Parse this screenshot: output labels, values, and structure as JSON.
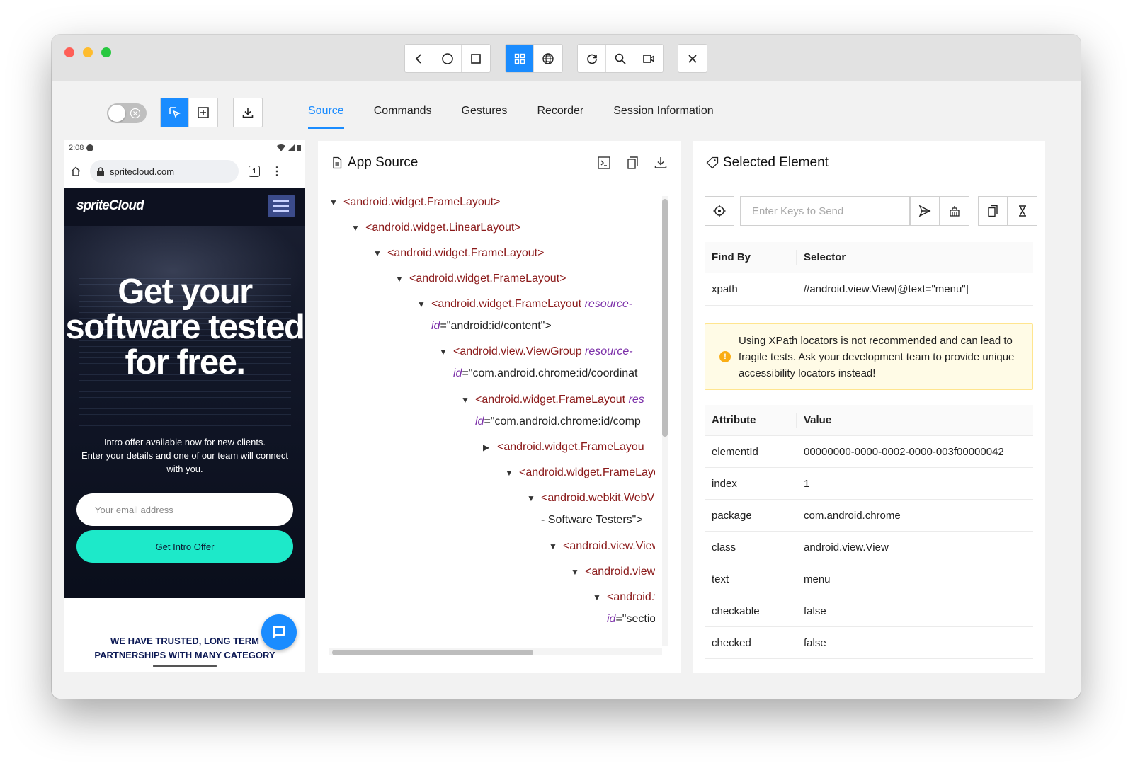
{
  "toolbar": {
    "top_icons": [
      "back-icon",
      "home-circle-icon",
      "app-switch-square-icon",
      "native-grid-icon",
      "web-globe-icon",
      "refresh-icon",
      "search-icon",
      "record-video-icon",
      "close-icon"
    ]
  },
  "mode_tabs": [
    {
      "label": "Source",
      "active": true
    },
    {
      "label": "Commands",
      "active": false
    },
    {
      "label": "Gestures",
      "active": false
    },
    {
      "label": "Recorder",
      "active": false
    },
    {
      "label": "Session Information",
      "active": false
    }
  ],
  "device": {
    "time": "2:08",
    "url": "spritecloud.com",
    "tab_count": "1",
    "logo": "spriteCloud",
    "headline": "Get your software tested for free.",
    "intro_line1": "Intro offer available now for new clients.",
    "intro_line2": "Enter your details and one of our team will connect with you.",
    "email_placeholder": "Your email address",
    "cta_label": "Get Intro Offer",
    "partners_line1": "WE HAVE TRUSTED, LONG TERM",
    "partners_line2": "PARTNERSHIPS WITH MANY CATEGORY"
  },
  "source_panel": {
    "title": "App Source",
    "tree": [
      {
        "tag": "<android.widget.FrameLayout>",
        "expanded": true
      },
      {
        "tag": "<android.widget.LinearLayout>",
        "expanded": true
      },
      {
        "tag": "<android.widget.FrameLayout>",
        "expanded": true
      },
      {
        "tag": "<android.widget.FrameLayout>",
        "expanded": true
      },
      {
        "tag": "<android.widget.FrameLayout ",
        "attr": "resource-",
        "cont_attr": "id",
        "cont_val": "=\"android:id/content\">",
        "expanded": true
      },
      {
        "tag": "<android.view.ViewGroup ",
        "attr": "resource-",
        "cont_attr": "id",
        "cont_val": "=\"com.android.chrome:id/coordinat",
        "expanded": true
      },
      {
        "tag": "<android.widget.FrameLayout ",
        "attr": "res",
        "cont_attr": "id",
        "cont_val": "=\"com.android.chrome:id/comp",
        "expanded": true
      },
      {
        "tag": "<android.widget.FrameLayou",
        "expanded": false
      },
      {
        "tag": "<android.widget.FrameLayou",
        "expanded": true
      },
      {
        "tag": "<android.webkit.WebView",
        "cont_val": "- Software Testers\">",
        "expanded": true
      },
      {
        "tag": "<android.view.View>",
        "expanded": true
      },
      {
        "tag": "<android.view.V",
        "expanded": true
      },
      {
        "tag": "<android.vie",
        "cont_attr": "id",
        "cont_val": "=\"section",
        "expanded": true
      }
    ]
  },
  "selected_panel": {
    "title": "Selected Element",
    "keys_placeholder": "Enter Keys to Send",
    "find_by_header": "Find By",
    "selector_header": "Selector",
    "find_by": "xpath",
    "selector": "//android.view.View[@text=\"menu\"]",
    "warning": "Using XPath locators is not recommended and can lead to fragile tests. Ask your development team to provide unique accessibility locators instead!",
    "attr_header": "Attribute",
    "value_header": "Value",
    "attributes": [
      {
        "name": "elementId",
        "value": "00000000-0000-0002-0000-003f00000042"
      },
      {
        "name": "index",
        "value": "1"
      },
      {
        "name": "package",
        "value": "com.android.chrome"
      },
      {
        "name": "class",
        "value": "android.view.View"
      },
      {
        "name": "text",
        "value": "menu"
      },
      {
        "name": "checkable",
        "value": "false"
      },
      {
        "name": "checked",
        "value": "false"
      }
    ]
  },
  "colors": {
    "accent": "#1a8cff",
    "tag": "#8b1a1a",
    "attr": "#7b2fa8",
    "cta": "#1de9c9",
    "warning_bg": "#fffbe6"
  }
}
